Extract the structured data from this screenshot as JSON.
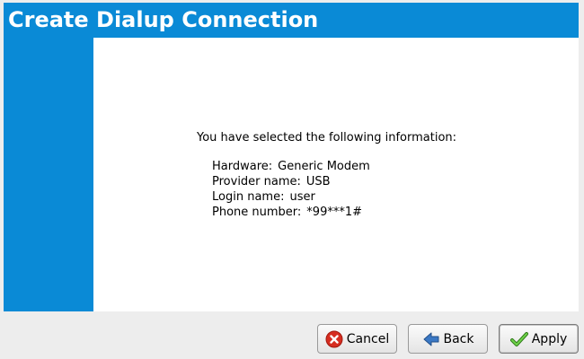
{
  "window": {
    "title": "Create Dialup Connection"
  },
  "content": {
    "summary_text": "You have selected the following information:",
    "details": [
      {
        "label": "Hardware:",
        "value": "Generic Modem"
      },
      {
        "label": "Provider name:",
        "value": "USB"
      },
      {
        "label": "Login name:",
        "value": "user"
      },
      {
        "label": "Phone number:",
        "value": "*99***1#"
      }
    ]
  },
  "buttons": {
    "cancel": {
      "label": "Cancel",
      "icon": "cancel-icon"
    },
    "back": {
      "label": "Back",
      "icon": "back-arrow-icon"
    },
    "apply": {
      "label": "Apply",
      "icon": "checkmark-icon"
    }
  },
  "colors": {
    "accent": "#0a8ad6",
    "cancel_icon": "#d62d20",
    "back_icon": "#3a78c4",
    "apply_icon": "#4caf2a"
  }
}
